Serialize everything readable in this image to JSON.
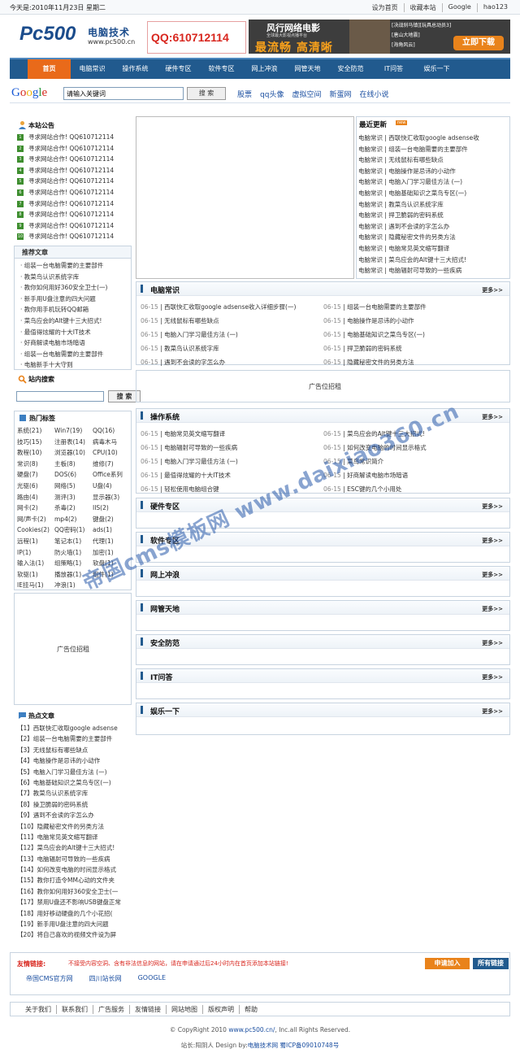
{
  "topbar": {
    "date": "今天是:2010年11月23日 星期二",
    "links": [
      "设为首页",
      "收藏本站",
      "Google",
      "hao123"
    ]
  },
  "header": {
    "logo_main": "Pc500",
    "logo_cn": "电脑技术",
    "logo_url": "www.pc500.cn",
    "qq": "QQ:610712114",
    "banner": {
      "title": "风行网络电影",
      "sub": "全球最大影视点播平台",
      "slogan": "最流畅 高清晰",
      "list": [
        "[决战刹马镇][玩具总动员3]",
        "[唐山大地震]",
        "[海角风云]"
      ],
      "button": "立即下载"
    }
  },
  "nav": [
    "首页",
    "电脑常识",
    "操作系统",
    "硬件专区",
    "软件专区",
    "网上冲浪",
    "网管天地",
    "安全防范",
    "IT问答",
    "娱乐一下"
  ],
  "search": {
    "engine": "Google",
    "placeholder": "请输入关键词",
    "button": "搜 索",
    "links": [
      "股票",
      "qq头像",
      "虚拟空间",
      "新蛋网",
      "在线小说"
    ]
  },
  "notice": {
    "title": "本站公告",
    "items": [
      "寻求网站合作! QQ610712114",
      "寻求网站合作! QQ610712114",
      "寻求网站合作! QQ610712114",
      "寻求网站合作! QQ610712114",
      "寻求网站合作! QQ610712114",
      "寻求网站合作! QQ610712114",
      "寻求网站合作! QQ610712114",
      "寻求网站合作! QQ610712114",
      "寻求网站合作! QQ610712114",
      "寻求网站合作! QQ610712114"
    ]
  },
  "recommend": {
    "title": "推荐文章",
    "items": [
      "组装一台电脑需要的主要部件",
      "教菜鸟认识系统字库",
      "教你如何用好360安全卫士(一)",
      "新手用U盘注意的四大问题",
      "教你用手机玩转QQ邮箱",
      "菜鸟应会的Alt键十三大招式!",
      "最值得炫耀的十大IT技术",
      "好商解读电脑市场暗语",
      "组装一台电脑需要的主要部件",
      "电脑新手十大守则"
    ]
  },
  "sitesearch": {
    "title": "站内搜索",
    "button": "搜 索"
  },
  "tags": {
    "title": "热门标签",
    "items": [
      "系统(21)",
      "Win7(19)",
      "QQ(16)",
      "技巧(15)",
      "注册表(14)",
      "病毒木马",
      "教程(10)",
      "浏览器(10)",
      "CPU(10)",
      "常识(8)",
      "主板(8)",
      "维修(7)",
      "硬盘(7)",
      "DOS(6)",
      "Office系列",
      "光驱(6)",
      "网络(5)",
      "U盘(4)",
      "路由(4)",
      "测评(3)",
      "显示器(3)",
      "网卡(2)",
      "杀毒(2)",
      "IIS(2)",
      "网/声卡(2)",
      "mp4(2)",
      "键盘(2)",
      "Cookies(2)",
      "QQ密码(1)",
      "ads(1)",
      "远程(1)",
      "笔记本(1)",
      "代理(1)",
      "IP(1)",
      "防火墙(1)",
      "加密(1)",
      "输入法(1)",
      "组策略(1)",
      "软盘(1)",
      "软驱(1)",
      "播放器(1)",
      "组件(1)",
      "IE挂马(1)",
      "冲浪(1)"
    ]
  },
  "ads": {
    "left": "广告位招租",
    "center": "广告位招租"
  },
  "hot": {
    "title": "热点文章",
    "items": [
      "【1】西联快汇收取google adsense",
      "【2】组装一台电脑需要的主要部件",
      "【3】无线鼠标有哪些缺点",
      "【4】电脑操作是忌讳的小动作",
      "【5】电脑入门学习最佳方法 (一)",
      "【6】电脑基础知识之菜鸟专区(一)",
      "【7】教菜鸟认识系统字库",
      "【8】操卫脆弱的密码系统",
      "【9】遇到不会读的字怎么办",
      "【10】隐藏秘密文件的另类方法",
      "【11】电脑常见英文缩写翻译",
      "【12】菜鸟应会的Alt键十三大招式!",
      "【13】电脑辐射可导致的一些疾病",
      "【14】如何改变电脑的时间显示格式",
      "【15】教你打造令MM心动的文件夹",
      "【16】教你如何用好360安全卫士(一",
      "【17】禁用U盘还不影响USB键盘正常",
      "【18】用好移动硬盘的几个小花招(",
      "【19】新手用U盘注意的四大问题",
      "【20】将自己喜欢的视频文件设为屏"
    ]
  },
  "latest": {
    "title": "最近更新",
    "badge": "new",
    "items": [
      "电脑常识 | 西联快汇收取google adsense收",
      "电脑常识 | 组装一台电脑需要的主要部件",
      "电脑常识 | 无线鼠标有哪些缺点",
      "电脑常识 | 电脑操作是忌讳的小动作",
      "电脑常识 | 电脑入门学习最佳方法 (一)",
      "电脑常识 | 电脑基础知识之菜鸟专区(一)",
      "电脑常识 | 教菜鸟认识系统字库",
      "电脑常识 | 捍卫脆弱的密码系统",
      "电脑常识 | 遇到不会读的字怎么办",
      "电脑常识 | 隐藏秘密文件的另类方法",
      "电脑常识 | 电脑常见英文缩写翻译",
      "电脑常识 | 菜鸟应会的Alt键十三大招式!",
      "电脑常识 | 电脑辐射可导致的一些疾病"
    ]
  },
  "sections": {
    "more": "更多>>",
    "common": {
      "title": "电脑常识",
      "items": [
        {
          "date": "06-15",
          "text": "西联快汇收取google adsense收入详细步骤(一)"
        },
        {
          "date": "06-15",
          "text": "组装一台电脑需要的主要部件"
        },
        {
          "date": "06-15",
          "text": "无线鼠标有哪些缺点"
        },
        {
          "date": "06-15",
          "text": "电脑操作是忌讳的小动作"
        },
        {
          "date": "06-15",
          "text": "电脑入门学习最佳方法 (一)"
        },
        {
          "date": "06-15",
          "text": "电脑基础知识之菜鸟专区(一)"
        },
        {
          "date": "06-15",
          "text": "教菜鸟认识系统字库"
        },
        {
          "date": "06-15",
          "text": "捍卫脆弱的密码系统"
        },
        {
          "date": "06-15",
          "text": "遇到不会读的字怎么办"
        },
        {
          "date": "06-15",
          "text": "隐藏秘密文件的另类方法"
        }
      ]
    },
    "os": {
      "title": "操作系统",
      "items": [
        {
          "date": "06-15",
          "text": "电脑常见英文缩写翻译"
        },
        {
          "date": "06-15",
          "text": "菜鸟应会的Alt键十三大招式!"
        },
        {
          "date": "06-15",
          "text": "电脑辐射可导致的一些疾病"
        },
        {
          "date": "06-15",
          "text": "如何改变电脑的时间显示格式"
        },
        {
          "date": "06-15",
          "text": "电脑入门学习最佳方法 (一)"
        },
        {
          "date": "06-15",
          "text": "菜鸟常识简介"
        },
        {
          "date": "06-15",
          "text": "最值得炫耀的十大IT技术"
        },
        {
          "date": "06-15",
          "text": "好商解读电脑市场暗语"
        },
        {
          "date": "06-15",
          "text": "轻松使用电脑组合键"
        },
        {
          "date": "06-15",
          "text": "ESC键的几个小用处"
        }
      ]
    },
    "empty": [
      "硬件专区",
      "软件专区",
      "网上冲浪",
      "网管天地",
      "安全防范",
      "IT问答",
      "娱乐一下"
    ]
  },
  "friend": {
    "title": "友情链接:",
    "notice": "不接受内容空洞、含有非法信息的网站，请在申请通过后24小时内在首页添加本站链接!",
    "apply": "申请加入",
    "all": "所有链接",
    "links": [
      "帝国CMS官方网",
      "四川站长网",
      "GOOGLE"
    ]
  },
  "footer": {
    "links": [
      "关于我们",
      "联系我们",
      "广告服务",
      "友情链接",
      "网站地图",
      "版权声明",
      "帮助"
    ],
    "copyright_pre": "© CopyRight 2010 ",
    "copyright_link": "www.pc500.cn/",
    "copyright_post": ", Inc.all Rights Reserved.",
    "icp_pre": "站长:阳阴人 Design by:",
    "icp_link": "电脑技术网",
    "icp_num": " 蜀ICP备09010748号"
  },
  "watermark": "帝国cms模板网 www.daixiao360.cn",
  "colors": {
    "nav": "#215a8e",
    "nav_active": "#e96a1a",
    "qq": "#d8261e"
  }
}
